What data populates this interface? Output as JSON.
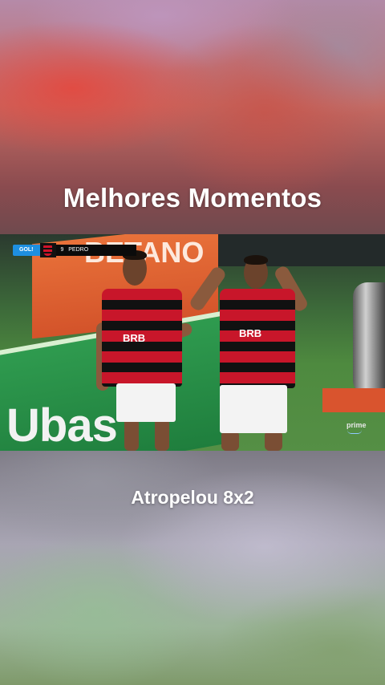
{
  "overlay": {
    "title": "Melhores Momentos",
    "caption": "Atropelou 8x2"
  },
  "video": {
    "scorebug": {
      "goal_label": "GOL!",
      "player_number": "9",
      "player_name": "PEDRO"
    },
    "sponsor_top": "BETANO",
    "sponsor_bottom": "Ubas",
    "jersey_sponsor": "BRB",
    "watermark": "prime"
  }
}
